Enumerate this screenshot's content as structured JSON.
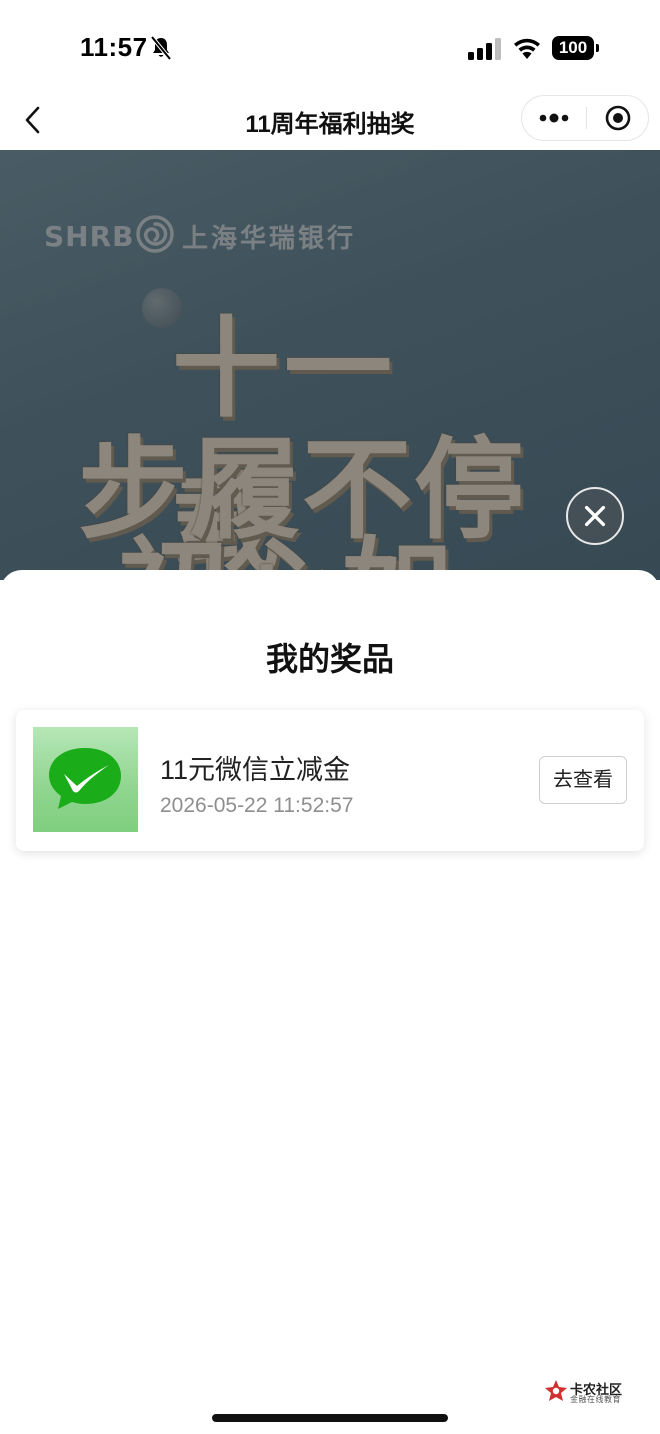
{
  "status_bar": {
    "time": "11:57",
    "battery": "100"
  },
  "nav": {
    "title": "11周年福利抽奖",
    "icons": [
      "back-arrow-icon",
      "more-dots-icon",
      "miniprogram-close-icon"
    ]
  },
  "banner": {
    "logo_text": "SHRB",
    "bank_name": "上海华瑞银行",
    "slogan_line1": "十一载",
    "slogan_line2": "步履不停",
    "slogan_line3": "初心如一",
    "close_icon": "close-circle-icon"
  },
  "sheet": {
    "title": "我的奖品",
    "prizes": [
      {
        "name": "11元微信立减金",
        "time": "2026-05-22 11:52:57",
        "button": "去查看",
        "icon": "wechat-pay-check-icon"
      }
    ]
  },
  "watermark": {
    "name": "卡农社区",
    "sub": "金融在线教育"
  },
  "colors": {
    "wechat_green": "#1AAD19",
    "banner_bg": "#4a6472",
    "slogan": "#f1e7d6"
  }
}
